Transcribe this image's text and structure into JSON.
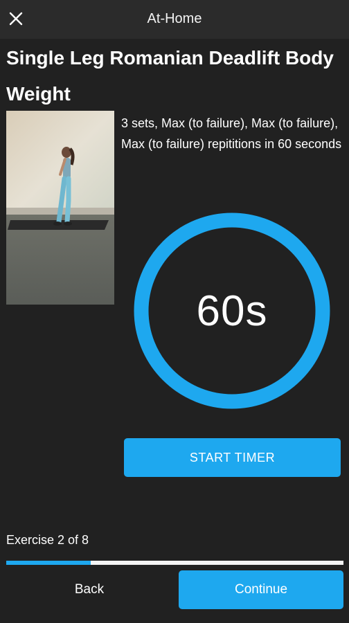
{
  "header": {
    "title": "At-Home",
    "close_icon": "close-icon"
  },
  "exercise": {
    "title": "Single Leg Romanian Deadlift Body Weight",
    "description": "3 sets, Max (to failure), Max (to failure), Max (to failure) repititions in 60 seconds"
  },
  "timer": {
    "display": "60s",
    "remaining_fraction": 1.0,
    "start_label": "START TIMER"
  },
  "progress": {
    "label": "Exercise 2 of 8",
    "current": 2,
    "total": 8
  },
  "footer": {
    "back_label": "Back",
    "continue_label": "Continue"
  },
  "colors": {
    "accent": "#1ea8ef",
    "background": "#212121",
    "header": "#2b2b2b"
  }
}
